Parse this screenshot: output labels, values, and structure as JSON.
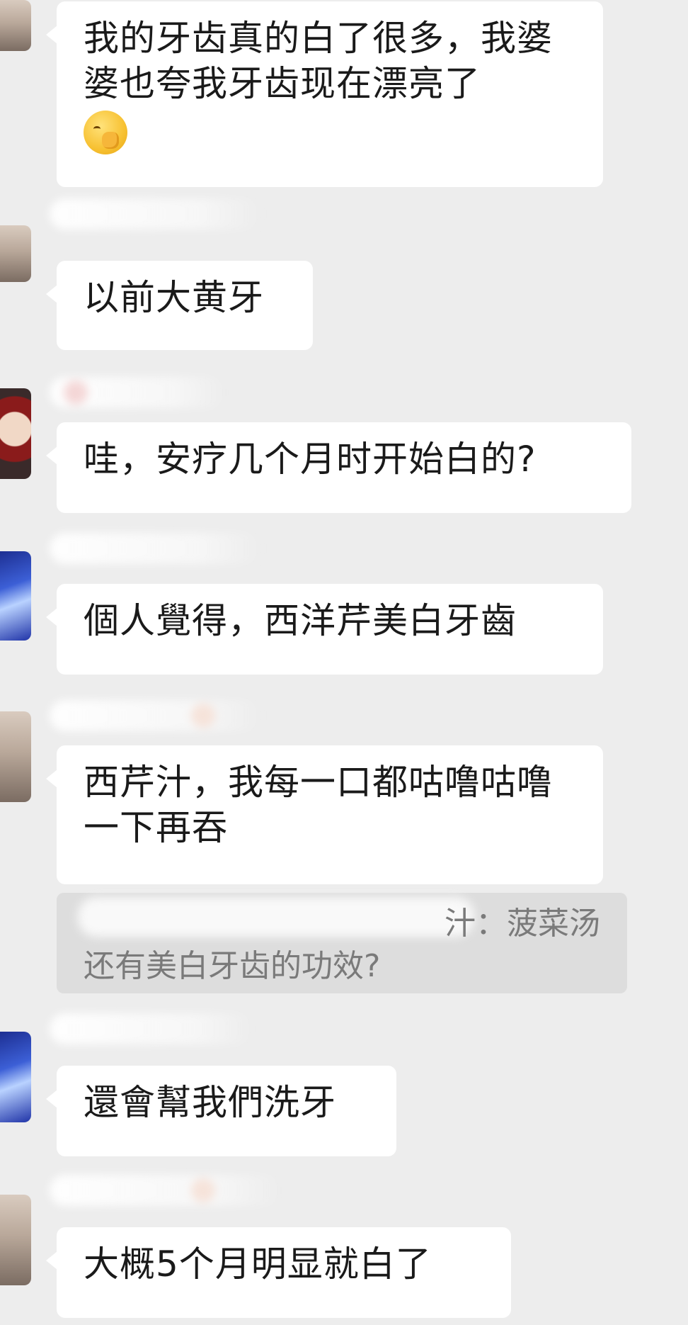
{
  "chat": {
    "messages": [
      {
        "sender": "member-1",
        "text": "我的牙齿真的白了很多，我婆婆也夸我牙齿现在漂亮了",
        "has_emoji": true,
        "emoji": "shy-hand-over-mouth-emoji"
      },
      {
        "sender": "member-1",
        "text": "以前大黄牙"
      },
      {
        "sender": "member-2",
        "text": "哇，安疗几个月时开始白的?"
      },
      {
        "sender": "member-3",
        "text": "個人覺得，西洋芹美白牙齒"
      },
      {
        "sender": "member-1",
        "text": "西芹汁，我每一口都咕噜咕噜一下再吞"
      },
      {
        "sender": "member-3",
        "text": "還會幫我們洗牙"
      },
      {
        "sender": "member-1",
        "text": "大概5个月明显就白了"
      }
    ],
    "quote": {
      "line1": "汁：菠菜汤",
      "line2": "还有美白牙齿的功效?"
    }
  },
  "colors": {
    "background": "#ededed",
    "bubble": "#ffffff",
    "quote_bg": "#dddddd",
    "text": "#1a1a1a",
    "quote_text": "#7a7a7a"
  }
}
